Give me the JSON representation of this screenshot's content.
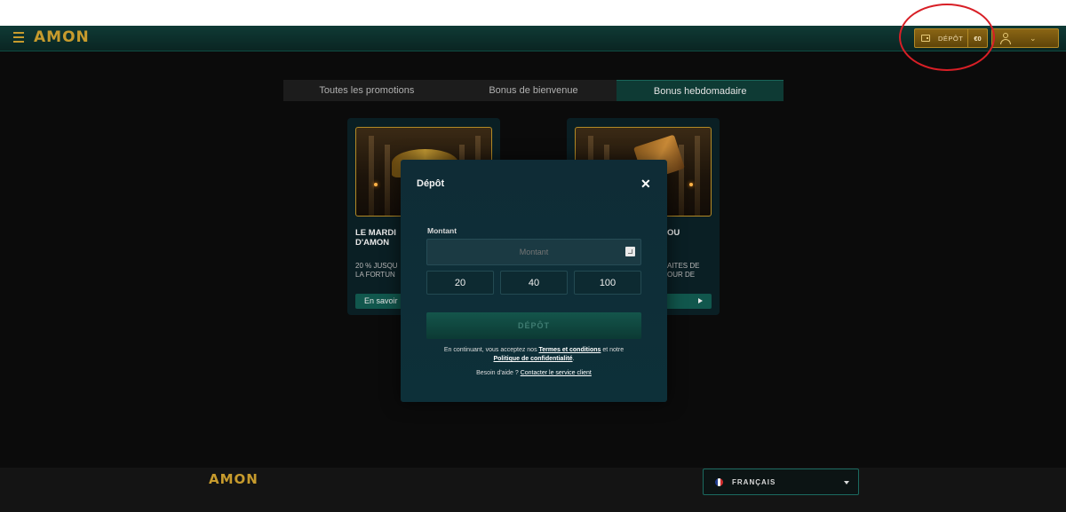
{
  "header": {
    "logo": "AMON",
    "deposit_label": "DÉPÔT",
    "balance": "€0"
  },
  "tabs": [
    {
      "label": "Toutes les promotions",
      "active": false
    },
    {
      "label": "Bonus de bienvenue",
      "active": false
    },
    {
      "label": "Bonus hebdomadaire",
      "active": true
    }
  ],
  "promos": [
    {
      "title": "LE MARDI\nD'AMON",
      "desc": "20 % JUSQU\nLA FORTUN",
      "button": "En savoir"
    },
    {
      "title": "OU",
      "desc": "AITES DE\nOUR DE",
      "button": ""
    }
  ],
  "modal": {
    "title": "Dépôt",
    "amount_label": "Montant",
    "amount_placeholder": "Montant",
    "amount_options": [
      "20",
      "40",
      "100"
    ],
    "submit_label": "DÉPÔT",
    "terms_prefix": "En continuant, vous acceptez nos ",
    "terms_link": "Termes et conditions",
    "terms_mid": " et notre ",
    "privacy_link": "Politique de confidentialité",
    "terms_suffix": ".",
    "help_prefix": "Besoin d'aide ? ",
    "help_link": "Contacter le service client"
  },
  "footer": {
    "logo": "AMON",
    "language": "FRANÇAIS"
  },
  "colors": {
    "gold": "#c79b2d",
    "teal": "#0e3a34",
    "annotation_red": "#d81f26"
  }
}
